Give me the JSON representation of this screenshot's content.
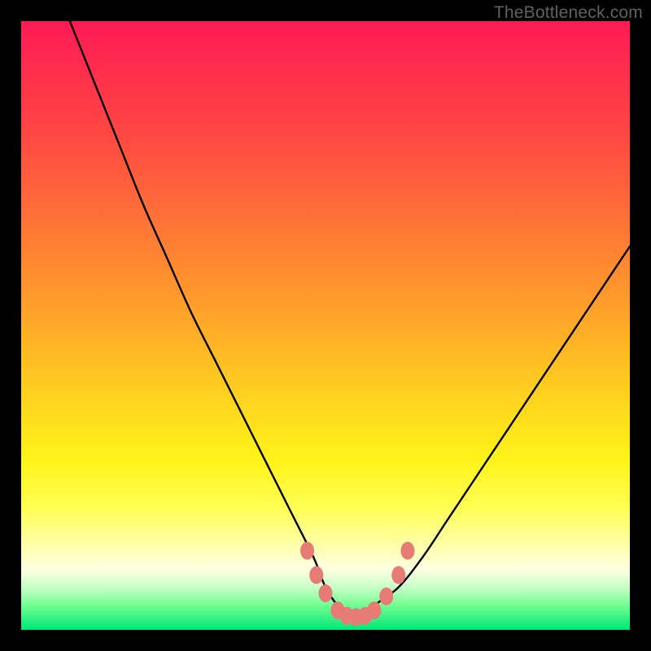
{
  "watermark": "TheBottleneck.com",
  "chart_data": {
    "type": "line",
    "title": "",
    "xlabel": "",
    "ylabel": "",
    "xlim": [
      0,
      100
    ],
    "ylim": [
      0,
      100
    ],
    "series": [
      {
        "name": "bottleneck-curve",
        "x": [
          8,
          12,
          16,
          20,
          24,
          28,
          32,
          36,
          40,
          44,
          48,
          50,
          52,
          54,
          56,
          58,
          62,
          66,
          70,
          74,
          78,
          82,
          86,
          90,
          94,
          98,
          100
        ],
        "y": [
          100,
          90,
          80,
          70,
          61,
          52,
          44,
          36,
          28,
          20,
          12,
          7,
          4,
          2,
          2,
          4,
          7,
          12,
          18,
          24,
          30,
          36,
          42,
          48,
          54,
          60,
          63
        ]
      }
    ],
    "markers": {
      "name": "highlighted-points",
      "color": "#e77b76",
      "points": [
        {
          "x": 47,
          "y": 13
        },
        {
          "x": 48.5,
          "y": 9
        },
        {
          "x": 50,
          "y": 6
        },
        {
          "x": 52,
          "y": 3.2
        },
        {
          "x": 53.5,
          "y": 2.3
        },
        {
          "x": 55,
          "y": 2.1
        },
        {
          "x": 56.5,
          "y": 2.3
        },
        {
          "x": 58,
          "y": 3.2
        },
        {
          "x": 60,
          "y": 5.5
        },
        {
          "x": 62,
          "y": 9
        },
        {
          "x": 63.5,
          "y": 13
        }
      ]
    },
    "gradient": {
      "top_color": "#ff1a55",
      "bottom_color": "#00e676"
    }
  }
}
